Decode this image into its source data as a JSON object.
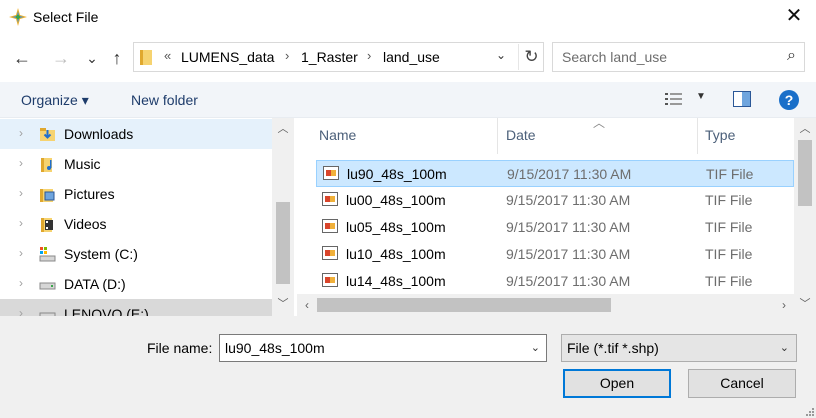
{
  "window": {
    "title": "Select File",
    "close_glyph": "✕"
  },
  "nav": {
    "back_glyph": "←",
    "forward_glyph": "→",
    "recent_glyph": "⌄",
    "up_glyph": "↑",
    "breadcrumb_prefix": "«",
    "breadcrumb": [
      "LUMENS_data",
      "1_Raster",
      "land_use"
    ],
    "breadcrumb_sep": "›",
    "dropdown_glyph": "⌄",
    "refresh_glyph": "↻",
    "search_placeholder": "Search land_use",
    "search_glyph": "⌕"
  },
  "toolbar": {
    "organize_label": "Organize ▾",
    "new_folder_label": "New folder",
    "view_dropdown_glyph": "▼",
    "help_glyph": "?"
  },
  "sidebar": {
    "chevron_glyph": "›",
    "items": [
      {
        "label": "Downloads",
        "icon": "downloads-icon"
      },
      {
        "label": "Music",
        "icon": "music-icon"
      },
      {
        "label": "Pictures",
        "icon": "pictures-icon"
      },
      {
        "label": "Videos",
        "icon": "videos-icon"
      },
      {
        "label": "System (C:)",
        "icon": "system-drive-icon"
      },
      {
        "label": "DATA (D:)",
        "icon": "drive-icon"
      },
      {
        "label": "LENOVO (E:)",
        "icon": "drive-icon"
      }
    ],
    "scroll_up_glyph": "︿",
    "scroll_down_glyph": "﹀"
  },
  "files": {
    "columns": [
      "Name",
      "Date",
      "Type"
    ],
    "sort_glyph": "︿",
    "rows": [
      {
        "name": "lu90_48s_100m",
        "date": "9/15/2017 11:30 AM",
        "type": "TIF File"
      },
      {
        "name": "lu00_48s_100m",
        "date": "9/15/2017 11:30 AM",
        "type": "TIF File"
      },
      {
        "name": "lu05_48s_100m",
        "date": "9/15/2017 11:30 AM",
        "type": "TIF File"
      },
      {
        "name": "lu10_48s_100m",
        "date": "9/15/2017 11:30 AM",
        "type": "TIF File"
      },
      {
        "name": "lu14_48s_100m",
        "date": "9/15/2017 11:30 AM",
        "type": "TIF File"
      }
    ],
    "scroll_left_glyph": "‹",
    "scroll_right_glyph": "›",
    "scroll_up_glyph": "︿",
    "scroll_down_glyph": "﹀"
  },
  "footer": {
    "file_name_label": "File name:",
    "file_name_value": "lu90_48s_100m",
    "file_name_dropdown_glyph": "⌄",
    "filter_value": "File (*.tif *.shp)",
    "filter_dropdown_glyph": "⌄",
    "open_label": "Open",
    "cancel_label": "Cancel"
  },
  "colors": {
    "accent": "#0078d7",
    "selection": "#cce8ff",
    "nav_selection": "#e5f1fb",
    "toolbar_bg": "#f2f5f9"
  }
}
